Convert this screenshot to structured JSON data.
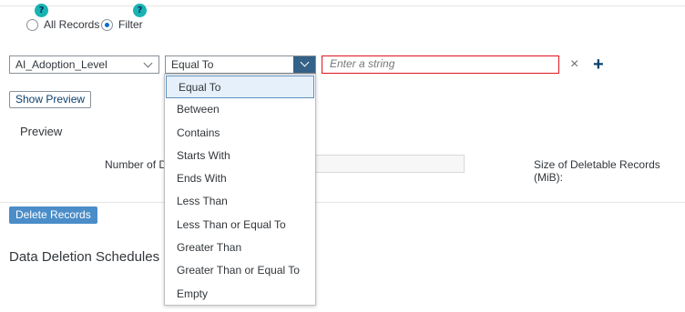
{
  "mode": {
    "options": [
      "All Records",
      "Filter"
    ],
    "selected": "Filter",
    "help_glyph": "?"
  },
  "filter": {
    "field_value": "AI_Adoption_Level",
    "operator_value": "Equal To",
    "value_placeholder": "Enter a string",
    "clear_icon": "×",
    "add_icon": "+"
  },
  "operator_menu": {
    "items": [
      "Equal To",
      "Between",
      "Contains",
      "Starts With",
      "Ends With",
      "Less Than",
      "Less Than or Equal To",
      "Greater Than",
      "Greater Than or Equal To",
      "Empty"
    ],
    "selected": "Equal To"
  },
  "preview": {
    "show_button": "Show Preview",
    "title": "Preview",
    "number_label_visible": "Number of De",
    "size_label": "Size of Deletable Records (MiB):"
  },
  "actions": {
    "delete_button": "Delete Records"
  },
  "schedules": {
    "title_visible": "Data Deletion Schedules (0"
  },
  "colors": {
    "accent": "#0a6ed1",
    "help_badge": "#19b3b3",
    "error_border": "#e0151e",
    "primary_button": "#4a8dc8",
    "operator_button": "#346187"
  }
}
